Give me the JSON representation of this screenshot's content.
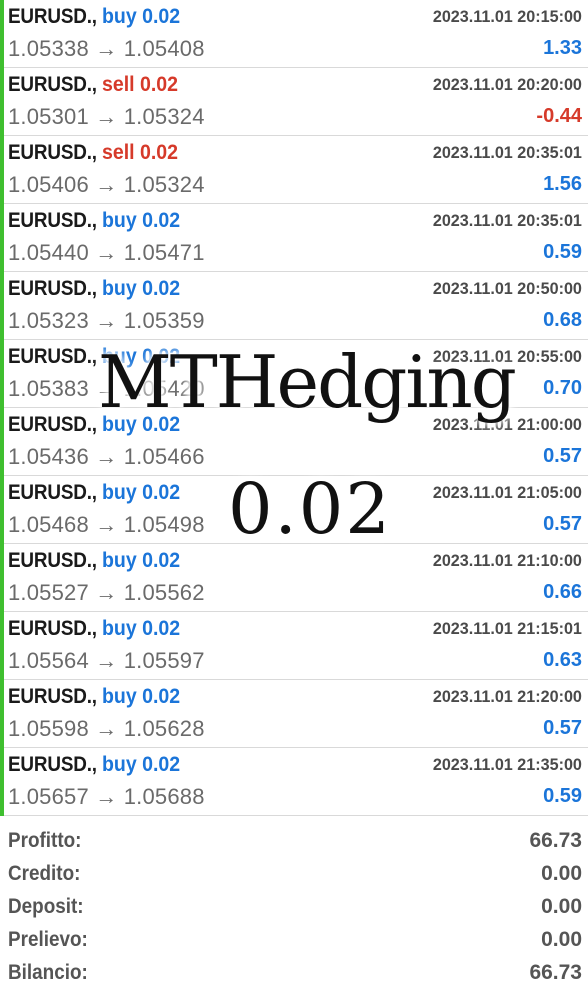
{
  "trades": [
    {
      "symbol": "EURUSD.,",
      "side": "buy 0.02",
      "side_type": "buy",
      "time": "2023.11.01 20:15:00",
      "prices": "1.05338 → 1.05408",
      "profit": "1.33",
      "profit_sign": "pos"
    },
    {
      "symbol": "EURUSD.,",
      "side": "sell 0.02",
      "side_type": "sell",
      "time": "2023.11.01 20:20:00",
      "prices": "1.05301 → 1.05324",
      "profit": "-0.44",
      "profit_sign": "neg"
    },
    {
      "symbol": "EURUSD.,",
      "side": "sell 0.02",
      "side_type": "sell",
      "time": "2023.11.01 20:35:01",
      "prices": "1.05406 → 1.05324",
      "profit": "1.56",
      "profit_sign": "pos"
    },
    {
      "symbol": "EURUSD.,",
      "side": "buy 0.02",
      "side_type": "buy",
      "time": "2023.11.01 20:35:01",
      "prices": "1.05440 → 1.05471",
      "profit": "0.59",
      "profit_sign": "pos"
    },
    {
      "symbol": "EURUSD.,",
      "side": "buy 0.02",
      "side_type": "buy",
      "time": "2023.11.01 20:50:00",
      "prices": "1.05323 → 1.05359",
      "profit": "0.68",
      "profit_sign": "pos"
    },
    {
      "symbol": "EURUSD.,",
      "side": "buy 0.02",
      "side_type": "buy",
      "time": "2023.11.01 20:55:00",
      "prices": "1.05383 → 1.05420",
      "profit": "0.70",
      "profit_sign": "pos"
    },
    {
      "symbol": "EURUSD.,",
      "side": "buy 0.02",
      "side_type": "buy",
      "time": "2023.11.01 21:00:00",
      "prices": "1.05436 → 1.05466",
      "profit": "0.57",
      "profit_sign": "pos"
    },
    {
      "symbol": "EURUSD.,",
      "side": "buy 0.02",
      "side_type": "buy",
      "time": "2023.11.01 21:05:00",
      "prices": "1.05468 → 1.05498",
      "profit": "0.57",
      "profit_sign": "pos"
    },
    {
      "symbol": "EURUSD.,",
      "side": "buy 0.02",
      "side_type": "buy",
      "time": "2023.11.01 21:10:00",
      "prices": "1.05527 → 1.05562",
      "profit": "0.66",
      "profit_sign": "pos"
    },
    {
      "symbol": "EURUSD.,",
      "side": "buy 0.02",
      "side_type": "buy",
      "time": "2023.11.01 21:15:01",
      "prices": "1.05564 → 1.05597",
      "profit": "0.63",
      "profit_sign": "pos"
    },
    {
      "symbol": "EURUSD.,",
      "side": "buy 0.02",
      "side_type": "buy",
      "time": "2023.11.01 21:20:00",
      "prices": "1.05598 → 1.05628",
      "profit": "0.57",
      "profit_sign": "pos"
    },
    {
      "symbol": "EURUSD.,",
      "side": "buy 0.02",
      "side_type": "buy",
      "time": "2023.11.01 21:35:00",
      "prices": "1.05657 → 1.05688",
      "profit": "0.59",
      "profit_sign": "pos"
    }
  ],
  "summary": [
    {
      "label": "Profitto:",
      "value": "66.73"
    },
    {
      "label": "Credito:",
      "value": "0.00"
    },
    {
      "label": "Deposit:",
      "value": "0.00"
    },
    {
      "label": "Prelievo:",
      "value": "0.00"
    },
    {
      "label": "Bilancio:",
      "value": "66.73"
    }
  ],
  "watermark": {
    "line1": "MTHedging",
    "line2": "0.02"
  },
  "colors": {
    "buy": "#1b75d9",
    "sell": "#d63a2a",
    "profit_accent_bar": "#3fbf2f"
  }
}
